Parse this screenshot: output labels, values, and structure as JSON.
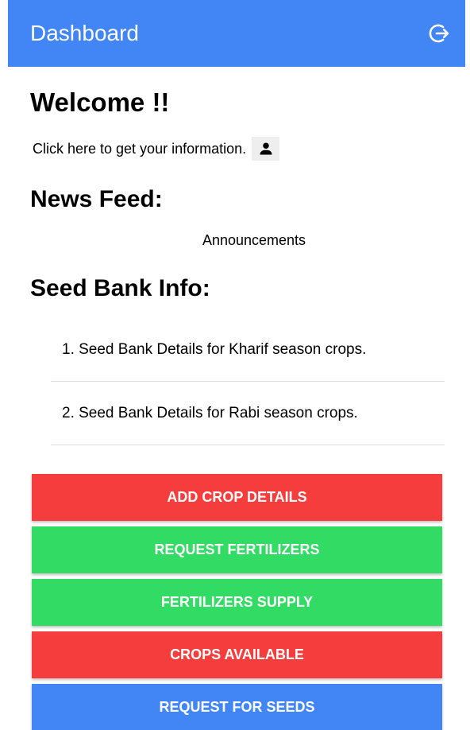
{
  "header": {
    "title": "Dashboard",
    "logout_icon": "logout-icon"
  },
  "welcome": {
    "title": "Welcome !!",
    "info_text": "Click here to get your information.",
    "info_icon": "person-icon"
  },
  "news": {
    "heading": "News Feed:",
    "announcements_label": "Announcements"
  },
  "seed_bank": {
    "heading": "Seed Bank Info:",
    "items": [
      {
        "label": "1. Seed Bank Details for Kharif season crops."
      },
      {
        "label": "2. Seed Bank Details for Rabi season crops."
      }
    ]
  },
  "actions": [
    {
      "label": "ADD CROP DETAILS",
      "color": "#f53d3d"
    },
    {
      "label": "REQUEST FERTILIZERS",
      "color": "#32db64"
    },
    {
      "label": "FERTILIZERS SUPPLY",
      "color": "#32db64"
    },
    {
      "label": "CROPS AVAILABLE",
      "color": "#f53d3d"
    },
    {
      "label": "REQUEST FOR SEEDS",
      "color": "#4285f4"
    }
  ],
  "colors": {
    "primary": "#4285f4",
    "danger": "#f53d3d",
    "secondary": "#32db64"
  }
}
